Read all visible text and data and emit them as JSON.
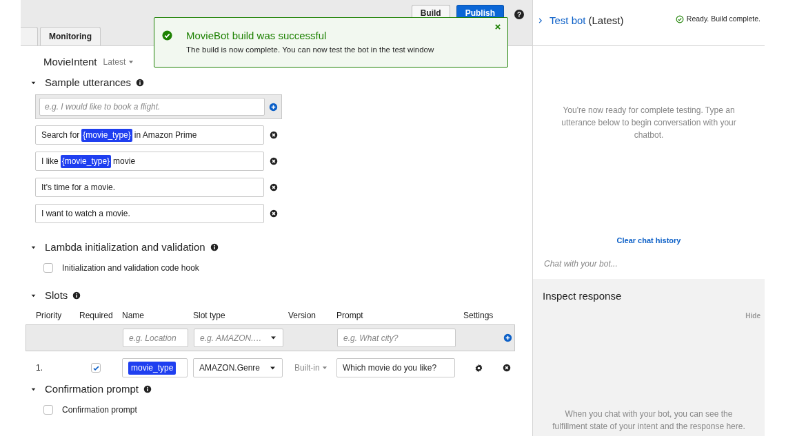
{
  "header": {
    "buttons": [
      {
        "label": "Build",
        "kind": "secondary"
      },
      {
        "label": "Publish",
        "kind": "primary"
      }
    ],
    "help": "?"
  },
  "tabs": [
    {
      "selected": false
    },
    {
      "label": "Monitoring",
      "selected": false
    }
  ],
  "toast": {
    "title": "MovieBot build was successful",
    "message": "The build is now complete. You can now test the bot in the test window"
  },
  "intent": {
    "name": "MovieIntent",
    "version": "Latest"
  },
  "sample_utterances": {
    "title": "Sample utterances",
    "placeholder": "e.g. I would like to book a flight.",
    "items": [
      [
        {
          "kind": "text",
          "text": "Search for"
        },
        {
          "kind": "slot",
          "text": "{movie_type}"
        },
        {
          "kind": "text",
          "text": "in Amazon Prime"
        }
      ],
      [
        {
          "kind": "text",
          "text": "I like"
        },
        {
          "kind": "slot",
          "text": "{movie_type}"
        },
        {
          "kind": "text",
          "text": "movie"
        }
      ],
      [
        {
          "kind": "text",
          "text": "It's time for a movie."
        }
      ],
      [
        {
          "kind": "text",
          "text": "I want to watch a movie."
        }
      ]
    ]
  },
  "lambda": {
    "title": "Lambda initialization and validation",
    "checkbox": {
      "label": "Initialization and validation code hook",
      "checked": false
    }
  },
  "slots": {
    "title": "Slots",
    "columns": [
      "Priority",
      "Required",
      "Name",
      "Slot type",
      "Version",
      "Prompt",
      "Settings"
    ],
    "new_row": {
      "name_placeholder": "e.g. Location",
      "type_placeholder": "e.g. AMAZON.…",
      "prompt_placeholder": "e.g. What city?"
    },
    "rows": [
      {
        "priority": "1.",
        "required": true,
        "name": "movie_type",
        "slot_type": "AMAZON.Genre",
        "version": "Built-in",
        "prompt": "Which movie do you like?"
      }
    ]
  },
  "confirmation": {
    "title": "Confirmation prompt",
    "checkbox": {
      "label": "Confirmation prompt",
      "checked": false
    }
  },
  "test_bot": {
    "title": "Test bot",
    "version": "(Latest)",
    "status": "Ready. Build complete.",
    "intro": "You're now ready for complete testing. Type an utterance below to begin conversation with your chatbot.",
    "clear": "Clear chat history",
    "chat_placeholder": "Chat with your bot...",
    "inspect": {
      "title": "Inspect response",
      "hide": "Hide",
      "hint": "When you chat with your bot, you can see the fulfillment state of your intent and the response here."
    }
  }
}
